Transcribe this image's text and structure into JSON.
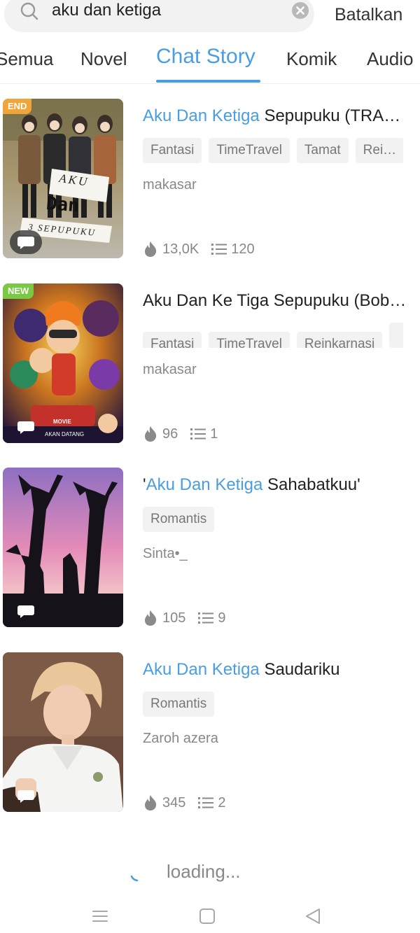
{
  "search": {
    "query": "aku dan ketiga",
    "cancel_label": "Batalkan"
  },
  "tabs": [
    {
      "label": "Semua"
    },
    {
      "label": "Novel"
    },
    {
      "label": "Chat Story",
      "active": true
    },
    {
      "label": "Komik"
    },
    {
      "label": "Audio"
    }
  ],
  "results": [
    {
      "badge": "END",
      "title_prefix": "",
      "title_highlight": "Aku Dan Ketiga",
      "title_rest": " Sepupuku (TRA…",
      "tags": [
        "Fantasi",
        "TimeTravel",
        "Tamat",
        "Rei…"
      ],
      "author": "makasar",
      "views": "13,0K",
      "chapters": "120",
      "cover_text": [
        "AKU",
        "Dan",
        "3 SEPUPUKU"
      ]
    },
    {
      "badge": "NEW",
      "title_prefix": "",
      "title_highlight": "",
      "title_rest": "Aku Dan Ke Tiga Sepupuku (Bob…",
      "tags": [
        "Fantasi",
        "TimeTravel",
        "Reinkarnasi",
        ""
      ],
      "author": "makasar",
      "views": "96",
      "chapters": "1",
      "cover_text": [
        "MOVIE",
        "AKAN DATANG"
      ]
    },
    {
      "badge": "",
      "title_prefix": "'",
      "title_highlight": "Aku Dan Ketiga",
      "title_rest": " Sahabatkuu'",
      "tags": [
        "Romantis"
      ],
      "author": "Sinta•_",
      "views": "105",
      "chapters": "9"
    },
    {
      "badge": "",
      "title_prefix": "",
      "title_highlight": "Aku Dan Ketiga",
      "title_rest": " Saudariku",
      "tags": [
        "Romantis"
      ],
      "author": "Zaroh azera",
      "views": "345",
      "chapters": "2"
    }
  ],
  "loading_text": "loading...",
  "colors": {
    "accent": "#4a9de0",
    "end_badge": "#f0a53a",
    "new_badge": "#7ac943"
  }
}
